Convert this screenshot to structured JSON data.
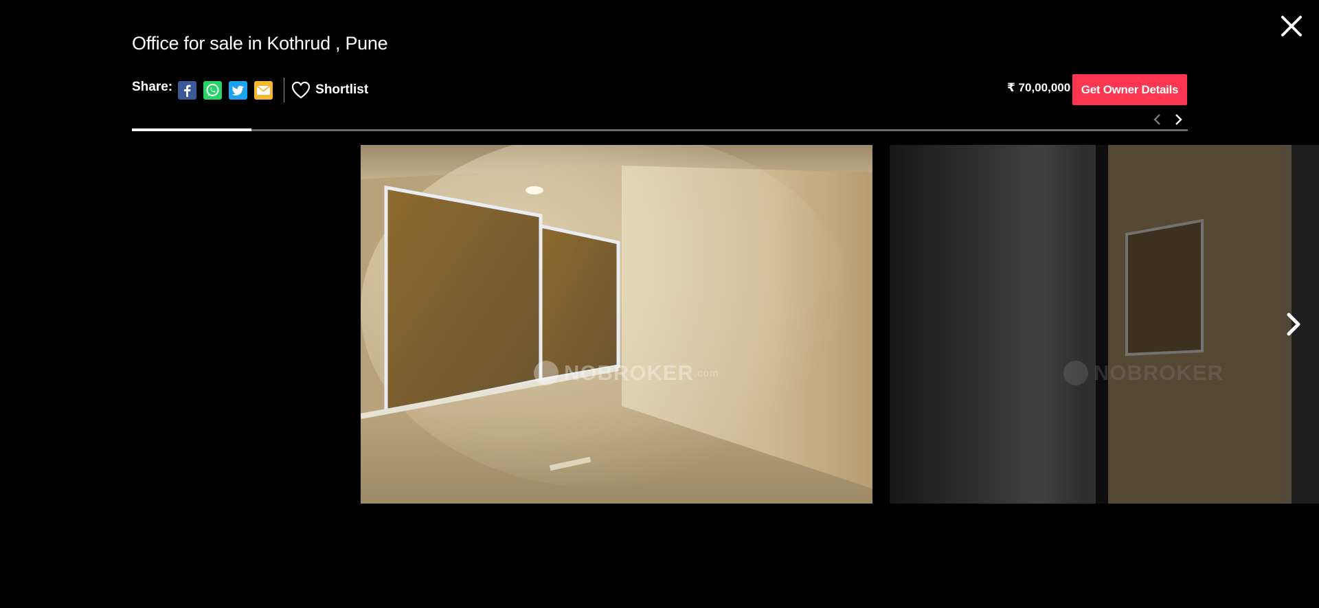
{
  "header": {
    "title": "Office for sale in Kothrud , Pune",
    "close_icon": "close-icon"
  },
  "share": {
    "label": "Share:",
    "icons": [
      "facebook-icon",
      "whatsapp-icon",
      "twitter-icon",
      "email-icon"
    ],
    "shortlist_label": "Shortlist"
  },
  "listing": {
    "price": "₹ 70,00,000",
    "cta_label": "Get Owner Details",
    "accent_color": "#fd3752"
  },
  "gallery": {
    "progress_fraction": 0.113,
    "current_photo": "office-room-photo",
    "next_photo": "office-corridor-photo",
    "watermark": "NOBROKER",
    "watermark_suffix": ".com"
  }
}
